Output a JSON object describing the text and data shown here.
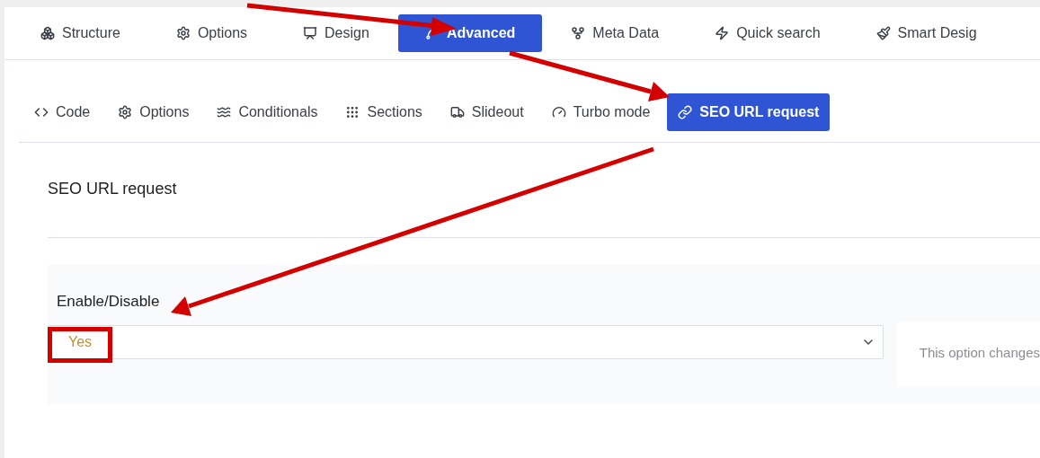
{
  "top_tabs": [
    {
      "label": "Structure",
      "selected": false
    },
    {
      "label": "Options",
      "selected": false
    },
    {
      "label": "Design",
      "selected": false
    },
    {
      "label": "Advanced",
      "selected": true
    },
    {
      "label": "Meta Data",
      "selected": false
    },
    {
      "label": "Quick search",
      "selected": false
    },
    {
      "label": "Smart Desig",
      "selected": false
    }
  ],
  "sub_tabs": [
    {
      "label": "Code",
      "selected": false
    },
    {
      "label": "Options",
      "selected": false
    },
    {
      "label": "Conditionals",
      "selected": false
    },
    {
      "label": "Sections",
      "selected": false
    },
    {
      "label": "Slideout",
      "selected": false
    },
    {
      "label": "Turbo mode",
      "selected": false
    },
    {
      "label": "SEO URL request",
      "selected": true
    }
  ],
  "section": {
    "title": "SEO URL request"
  },
  "field": {
    "label": "Enable/Disable",
    "value": "Yes",
    "help": "This option changes"
  }
}
